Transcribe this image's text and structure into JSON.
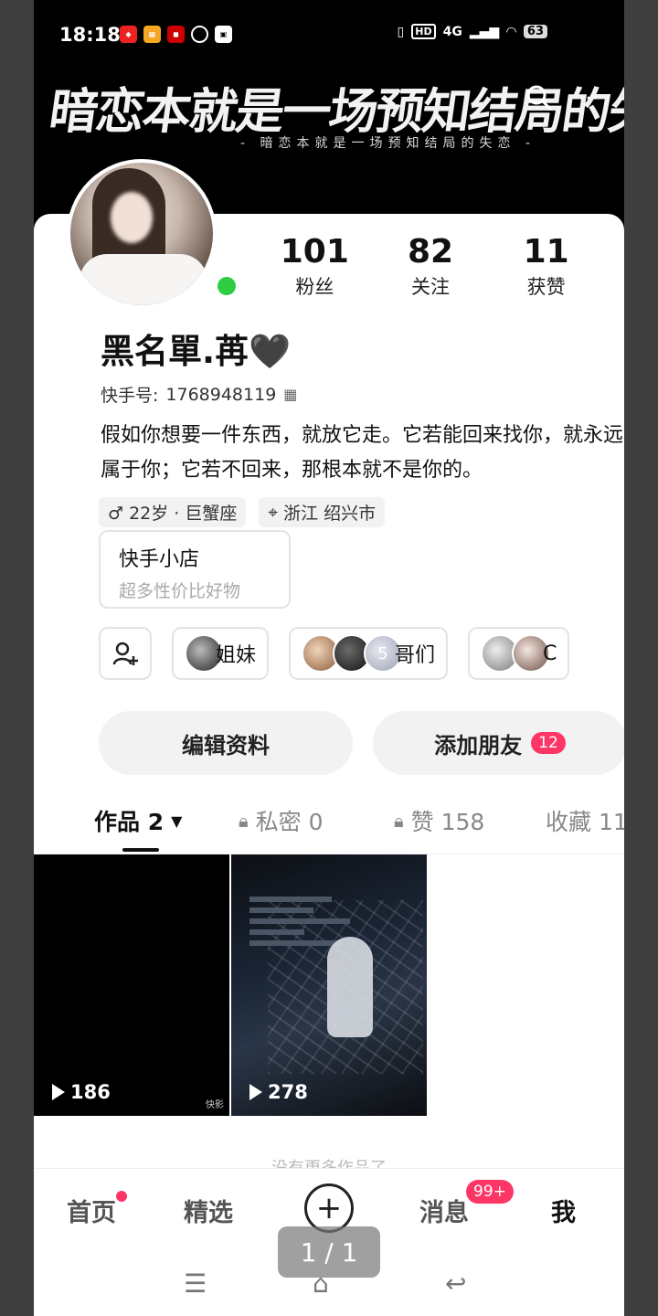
{
  "status_bar": {
    "time": "18:18",
    "network": "4G",
    "battery": "63",
    "hd": "HD"
  },
  "banner": {
    "calligraphy": "暗恋本就是一场预知结局的失恋",
    "subtitle": "- 暗恋本就是一场预知结局的失恋 -"
  },
  "profile": {
    "nickname": "黑名單.苒",
    "heart": "🖤",
    "kuaishou_id_label": "快手号:",
    "kuaishou_id": "1768948119",
    "bio": "假如你想要一件东西，就放它走。它若能回来找你，就永远属于你；它若不回来，那根本就不是你的。",
    "stats": [
      {
        "value": "101",
        "label": "粉丝"
      },
      {
        "value": "82",
        "label": "关注"
      },
      {
        "value": "11",
        "label": "获赞"
      }
    ],
    "tags": {
      "gender_age": "♂ 22岁 · 巨蟹座",
      "location": "浙江 绍兴市"
    },
    "shop": {
      "title": "快手小店",
      "subtitle": "超多性价比好物"
    },
    "groups": [
      {
        "label": "姐妹"
      },
      {
        "label": "哥们",
        "count": "5"
      },
      {
        "label": "C"
      }
    ],
    "buttons": {
      "edit": "编辑资料",
      "add_friend": "添加朋友",
      "add_friend_badge": "12"
    }
  },
  "tabs": [
    {
      "label": "作品 2",
      "active": true
    },
    {
      "label": "私密 0"
    },
    {
      "label": "赞 158"
    },
    {
      "label": "收藏 11"
    }
  ],
  "videos": [
    {
      "plays": "186",
      "watermark": "快影"
    },
    {
      "plays": "278"
    }
  ],
  "no_more_text": "没有更多作品了",
  "bottom_nav": {
    "home": "首页",
    "featured": "精选",
    "plus": "+",
    "messages": "消息",
    "messages_badge": "99+",
    "me": "我"
  },
  "page_indicator": "1 / 1",
  "colors": {
    "accent": "#fe3666",
    "online": "#2ecc40"
  }
}
